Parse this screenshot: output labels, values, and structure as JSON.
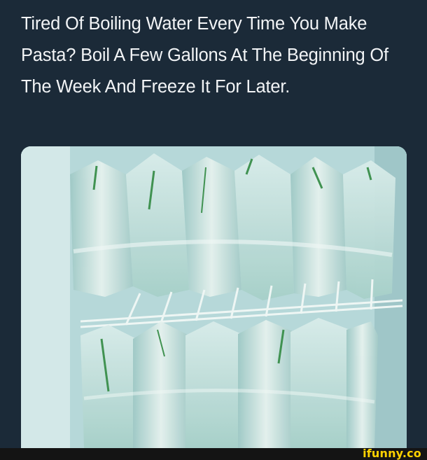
{
  "post": {
    "caption": "Tired Of Boiling Water Every Time You Make Pasta? Boil A Few Gallons At The Beginning Of The Week And Freeze It For Later."
  },
  "photo": {
    "icon": "freezer-water-bags-photo"
  },
  "footer": {
    "watermark": "ifunny.co",
    "brand_color": "#ffd200"
  }
}
